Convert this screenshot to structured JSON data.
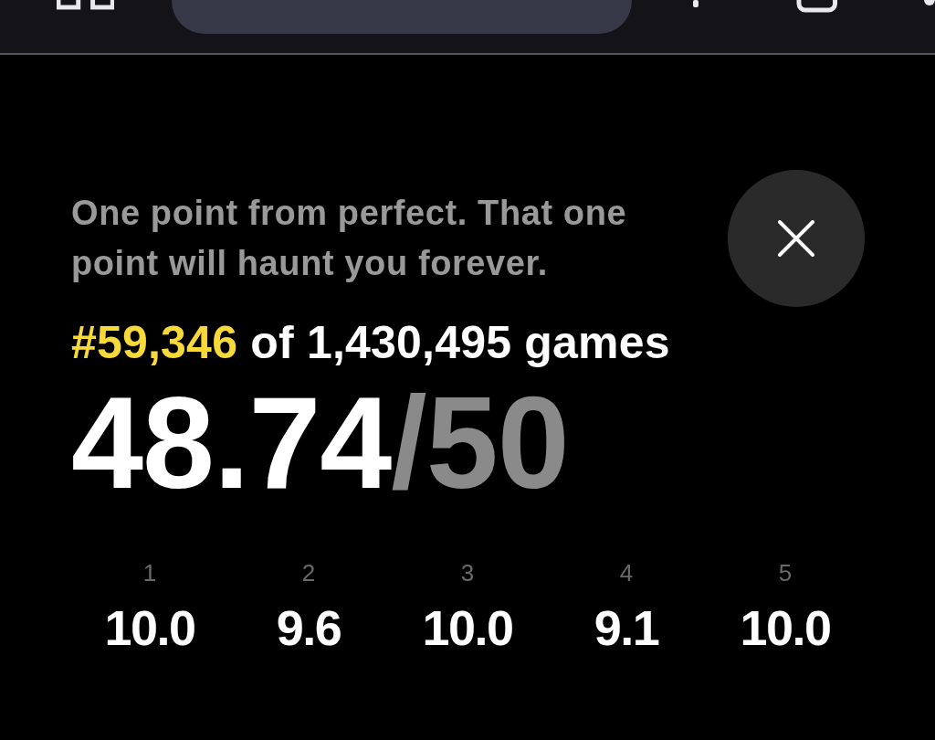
{
  "message": "One point from perfect. That one point will haunt you forever.",
  "rank": {
    "position": "#59,346",
    "total": "of 1,430,495 games"
  },
  "score": {
    "value": "48.74",
    "max": "/50"
  },
  "rounds": [
    {
      "number": "1",
      "score": "10.0"
    },
    {
      "number": "2",
      "score": "9.6"
    },
    {
      "number": "3",
      "score": "10.0"
    },
    {
      "number": "4",
      "score": "9.1"
    },
    {
      "number": "5",
      "score": "10.0"
    }
  ]
}
